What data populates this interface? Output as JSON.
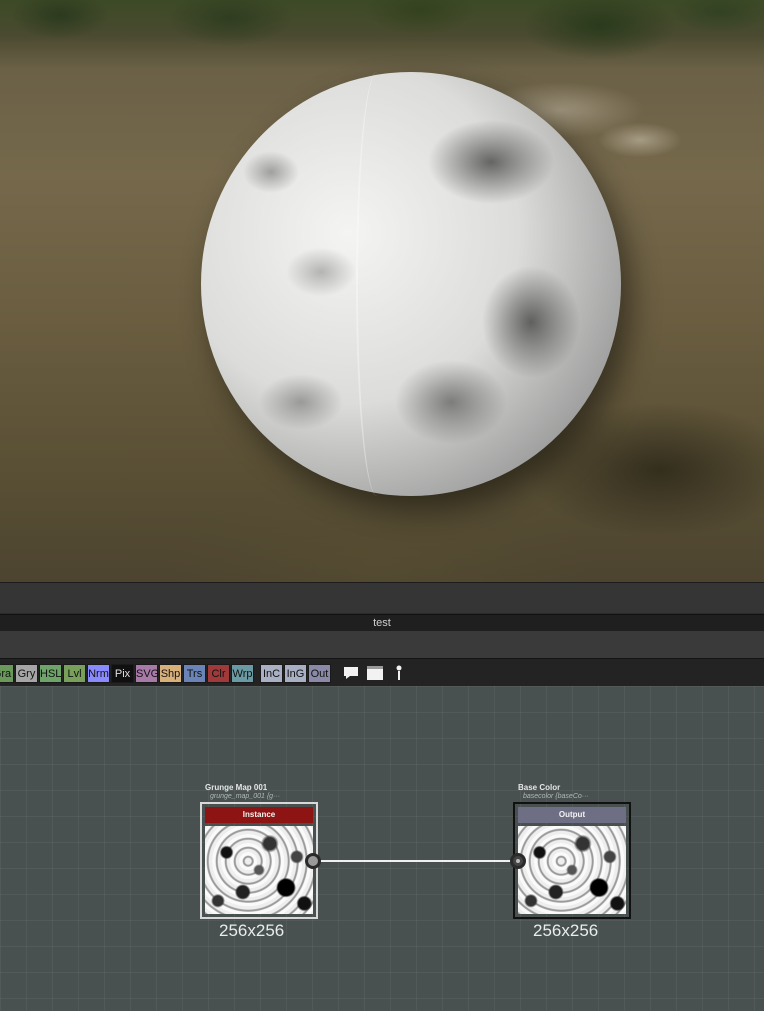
{
  "graph_title": "test",
  "toolbar": {
    "buttons": [
      {
        "label": "Gra",
        "color": "#6a9a5a"
      },
      {
        "label": "Gry",
        "color": "#a6a6a6"
      },
      {
        "label": "HSL",
        "color": "#6ea36a"
      },
      {
        "label": "Lvl",
        "color": "#78a05a"
      },
      {
        "label": "Nrm",
        "color": "#8a8aff"
      },
      {
        "label": "Pix",
        "color": "#101010",
        "text_color": "#e0e0e0"
      },
      {
        "label": "SVG",
        "color": "#a87aa8"
      },
      {
        "label": "Shp",
        "color": "#d8b07a"
      },
      {
        "label": "Trs",
        "color": "#6a84b8"
      },
      {
        "label": "Clr",
        "color": "#a03a3a"
      },
      {
        "label": "Wrp",
        "color": "#6a9aa4"
      },
      {
        "label": "InC",
        "color": "#aab0c4"
      },
      {
        "label": "InG",
        "color": "#aab0c4"
      },
      {
        "label": "Out",
        "color": "#8a8aa8"
      }
    ],
    "icons": [
      "comment-icon",
      "frame-icon",
      "pin-icon"
    ]
  },
  "nodes": [
    {
      "title": "Grunge Map 001",
      "subtitle": "grunge_map_001 {g···",
      "header": "Instance",
      "header_color": "#8e1414",
      "header_text_color": "#f4f4f4",
      "resolution": "256x256",
      "selected": true
    },
    {
      "title": "Base Color",
      "subtitle": "basecolor {baseCo···",
      "header": "Output",
      "header_color": "#6e6e84",
      "header_text_color": "#f4f4f4",
      "resolution": "256x256",
      "selected": false
    }
  ]
}
